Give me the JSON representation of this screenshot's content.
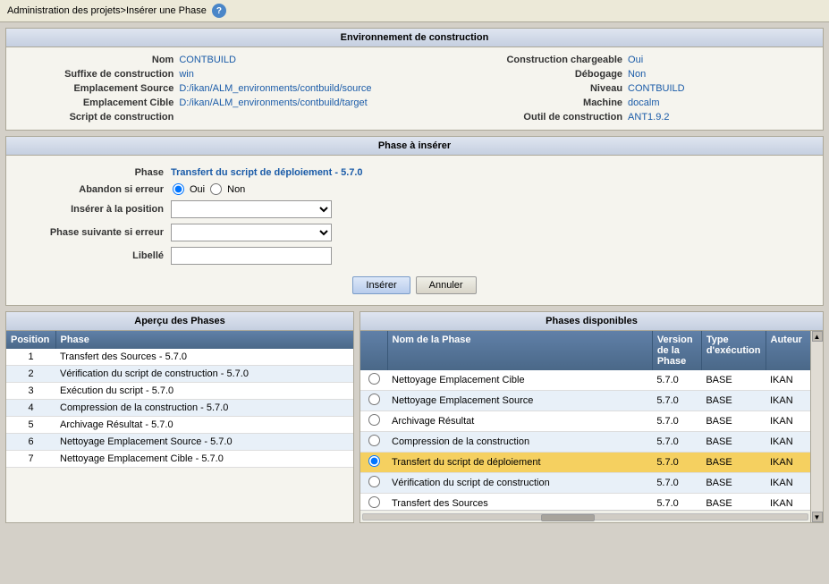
{
  "header": {
    "breadcrumb": "Administration des projets>Insérer une Phase",
    "help_icon": "?"
  },
  "env_section": {
    "title": "Environnement de construction",
    "fields": {
      "nom_label": "Nom",
      "nom_value": "CONTBUILD",
      "construction_chargeable_label": "Construction chargeable",
      "construction_chargeable_value": "Oui",
      "suffixe_label": "Suffixe de construction",
      "suffixe_value": "win",
      "debogage_label": "Débogage",
      "debogage_value": "Non",
      "emplacement_source_label": "Emplacement Source",
      "emplacement_source_value": "D:/ikan/ALM_environments/contbuild/source",
      "niveau_label": "Niveau",
      "niveau_value": "CONTBUILD",
      "emplacement_cible_label": "Emplacement Cible",
      "emplacement_cible_value": "D:/ikan/ALM_environments/contbuild/target",
      "machine_label": "Machine",
      "machine_value": "docalm",
      "script_label": "Script de construction",
      "outil_label": "Outil de construction",
      "outil_value": "ANT1.9.2"
    }
  },
  "phase_section": {
    "title": "Phase à insérer",
    "phase_label": "Phase",
    "phase_value": "Transfert du script de déploiement - 5.7.0",
    "abandon_label": "Abandon si erreur",
    "radio_oui": "Oui",
    "radio_non": "Non",
    "insert_position_label": "Insérer à la position",
    "next_phase_label": "Phase suivante si erreur",
    "libelle_label": "Libellé",
    "btn_insert": "Insérer",
    "btn_cancel": "Annuler"
  },
  "overview_section": {
    "title": "Aperçu des Phases",
    "col_position": "Position",
    "col_phase": "Phase",
    "rows": [
      {
        "position": "1",
        "phase": "Transfert des Sources - 5.7.0"
      },
      {
        "position": "2",
        "phase": "Vérification du script de construction - 5.7.0"
      },
      {
        "position": "3",
        "phase": "Exécution du script - 5.7.0"
      },
      {
        "position": "4",
        "phase": "Compression de la construction - 5.7.0"
      },
      {
        "position": "5",
        "phase": "Archivage Résultat - 5.7.0"
      },
      {
        "position": "6",
        "phase": "Nettoyage Emplacement Source - 5.7.0"
      },
      {
        "position": "7",
        "phase": "Nettoyage Emplacement Cible - 5.7.0"
      }
    ]
  },
  "available_section": {
    "title": "Phases disponibles",
    "col_name": "Nom de la Phase",
    "col_version": "Version de la Phase",
    "col_type": "Type d'exécution",
    "col_author": "Auteur",
    "rows": [
      {
        "name": "Nettoyage Emplacement Cible",
        "version": "5.7.0",
        "type": "BASE",
        "author": "IKAN",
        "selected": false,
        "striped": true
      },
      {
        "name": "Nettoyage Emplacement Source",
        "version": "5.7.0",
        "type": "BASE",
        "author": "IKAN",
        "selected": false,
        "striped": false
      },
      {
        "name": "Archivage Résultat",
        "version": "5.7.0",
        "type": "BASE",
        "author": "IKAN",
        "selected": false,
        "striped": true
      },
      {
        "name": "Compression de la construction",
        "version": "5.7.0",
        "type": "BASE",
        "author": "IKAN",
        "selected": false,
        "striped": false
      },
      {
        "name": "Transfert du script de déploiement",
        "version": "5.7.0",
        "type": "BASE",
        "author": "IKAN",
        "selected": true,
        "striped": false
      },
      {
        "name": "Vérification du script de construction",
        "version": "5.7.0",
        "type": "BASE",
        "author": "IKAN",
        "selected": false,
        "striped": false
      },
      {
        "name": "Transfert des Sources",
        "version": "5.7.0",
        "type": "BASE",
        "author": "IKAN",
        "selected": false,
        "striped": true
      }
    ]
  }
}
